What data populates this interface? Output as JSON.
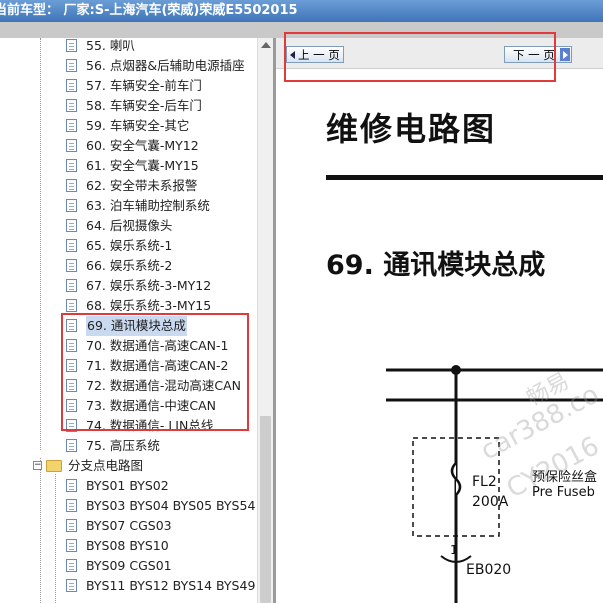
{
  "window": {
    "title": "当前车型：  厂家:S-上海汽车(荣威)荣威E5502015"
  },
  "tree": {
    "items": [
      {
        "label": "55. 喇叭"
      },
      {
        "label": "56. 点烟器&后辅助电源插座"
      },
      {
        "label": "57. 车辆安全-前车门"
      },
      {
        "label": "58. 车辆安全-后车门"
      },
      {
        "label": "59. 车辆安全-其它"
      },
      {
        "label": "60. 安全气囊-MY12"
      },
      {
        "label": "61. 安全气囊-MY15"
      },
      {
        "label": "62. 安全带未系报警"
      },
      {
        "label": "63. 泊车辅助控制系统"
      },
      {
        "label": "64. 后视摄像头"
      },
      {
        "label": "65. 娱乐系统-1"
      },
      {
        "label": "66. 娱乐系统-2"
      },
      {
        "label": "67. 娱乐系统-3-MY12"
      },
      {
        "label": "68. 娱乐系统-3-MY15"
      },
      {
        "label": "69. 通讯模块总成"
      },
      {
        "label": "70. 数据通信-高速CAN-1"
      },
      {
        "label": "71. 数据通信-高速CAN-2"
      },
      {
        "label": "72. 数据通信-混动高速CAN"
      },
      {
        "label": "73. 数据通信-中速CAN"
      },
      {
        "label": "74. 数据通信- LIN总线"
      },
      {
        "label": "75. 高压系统"
      }
    ],
    "folder": {
      "label": "分支点电路图"
    },
    "sub_items": [
      {
        "label": "BYS01 BYS02"
      },
      {
        "label": "BYS03 BYS04 BYS05 BYS54"
      },
      {
        "label": "BYS07 CGS03"
      },
      {
        "label": "BYS08 BYS10"
      },
      {
        "label": "BYS09 CGS01"
      },
      {
        "label": "BYS11 BYS12 BYS14 BYS49"
      }
    ]
  },
  "viewer": {
    "prev_label": "上 一 页",
    "next_label": "下 一 页",
    "doc_title": "维修电路图",
    "section_title": "69. 通讯模块总成",
    "diagram": {
      "fuse_name": "FL2",
      "fuse_rating": "200A",
      "side_label_1": "预保险丝盒",
      "side_label_2": "Pre Fuseb",
      "pin": "1",
      "connector": "EB020"
    },
    "watermarks": [
      "畅易",
      "car388.co",
      "CY2016"
    ]
  },
  "colors": {
    "highlight": "#e23a3a",
    "title_bar": "#4a80c2",
    "selected_bg": "#c8d9f0"
  }
}
